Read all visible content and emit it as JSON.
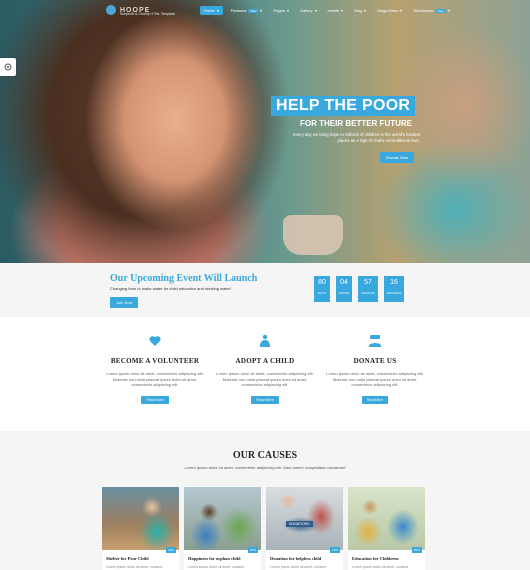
{
  "header": {
    "logo_text": "HOOPE",
    "logo_tagline": "Nonprofit & Charity HTML Template",
    "nav": [
      {
        "label": "Home",
        "active": true,
        "badge": "",
        "caret": true
      },
      {
        "label": "Features",
        "active": false,
        "badge": "New",
        "caret": true
      },
      {
        "label": "Pages",
        "active": false,
        "badge": "",
        "caret": true
      },
      {
        "label": "Gallery",
        "active": false,
        "badge": "",
        "caret": true
      },
      {
        "label": "events",
        "active": false,
        "badge": "",
        "caret": true
      },
      {
        "label": "Blog",
        "active": false,
        "badge": "",
        "caret": true
      },
      {
        "label": "Mega Menu",
        "active": false,
        "badge": "",
        "caret": true
      },
      {
        "label": "Shortcodes",
        "active": false,
        "badge": "New",
        "caret": true
      }
    ]
  },
  "hero": {
    "title": "HELP THE POOR",
    "subtitle": "FOR THEIR BETTER FUTURE",
    "text": "Every day we bring hope to millions of children in the world's hardest places as a sign of God's unconditional love.",
    "button": "Donate Now"
  },
  "event": {
    "title": "Our Upcoming Event Will Launch",
    "subtitle": "Changing lives to make water for child education and drinking water!",
    "button": "Join Now",
    "countdown": [
      {
        "value": "80",
        "label": "DAYS"
      },
      {
        "value": "04",
        "label": "HOURS"
      },
      {
        "value": "57",
        "label": "MINUTES"
      },
      {
        "value": "16",
        "label": "SECONDS"
      }
    ]
  },
  "actions": [
    {
      "title": "BECOME A VOLUNTEER",
      "text": "Lorem ipsum dolor sit amet, consectetur adipiscing elit. Molestie non nulla placeat ipsum dolor sit amet, consectetur adipiscing elit.",
      "button": "Read More",
      "icon": "hands-heart-icon"
    },
    {
      "title": "ADOPT A CHILD",
      "text": "Lorem ipsum dolor sit amet, consectetur adipiscing elit. Molestie non nulla placeat ipsum dolor sit amet, consectetur adipiscing elit.",
      "button": "Read More",
      "icon": "hands-child-icon"
    },
    {
      "title": "DONATE US",
      "text": "Lorem ipsum dolor sit amet, consectetur adipiscing elit. Molestie non nulla placeat ipsum dolor sit amet, consectetur adipiscing elit.",
      "button": "ReadMore",
      "icon": "donate-icon"
    }
  ],
  "causes": {
    "title": "OUR CAUSES",
    "subtitle": "Lorem ipsum dolor sit amet, consectetur adipiscing elit. Nam autem voluptatibus obcaecati!",
    "cards": [
      {
        "title": "Shelter for Poor Child",
        "text": "Lorem ipsum dolor sit amet, consect",
        "tag": "40%",
        "img_label": ""
      },
      {
        "title": "Happiness for orphan child",
        "text": "Lorem ipsum dolor sit amet, consect",
        "tag": "60%",
        "img_label": ""
      },
      {
        "title": "Donation for helpless child",
        "text": "Lorem ipsum dolor sit amet, consect",
        "tag": "70%",
        "img_label": "DONATIONS"
      },
      {
        "title": "Education for Childrens",
        "text": "Lorem ipsum dolor sit amet, consect",
        "tag": "50%",
        "img_label": ""
      }
    ]
  },
  "colors": {
    "accent": "#38a8de",
    "light_bg": "#f5f5f5"
  }
}
